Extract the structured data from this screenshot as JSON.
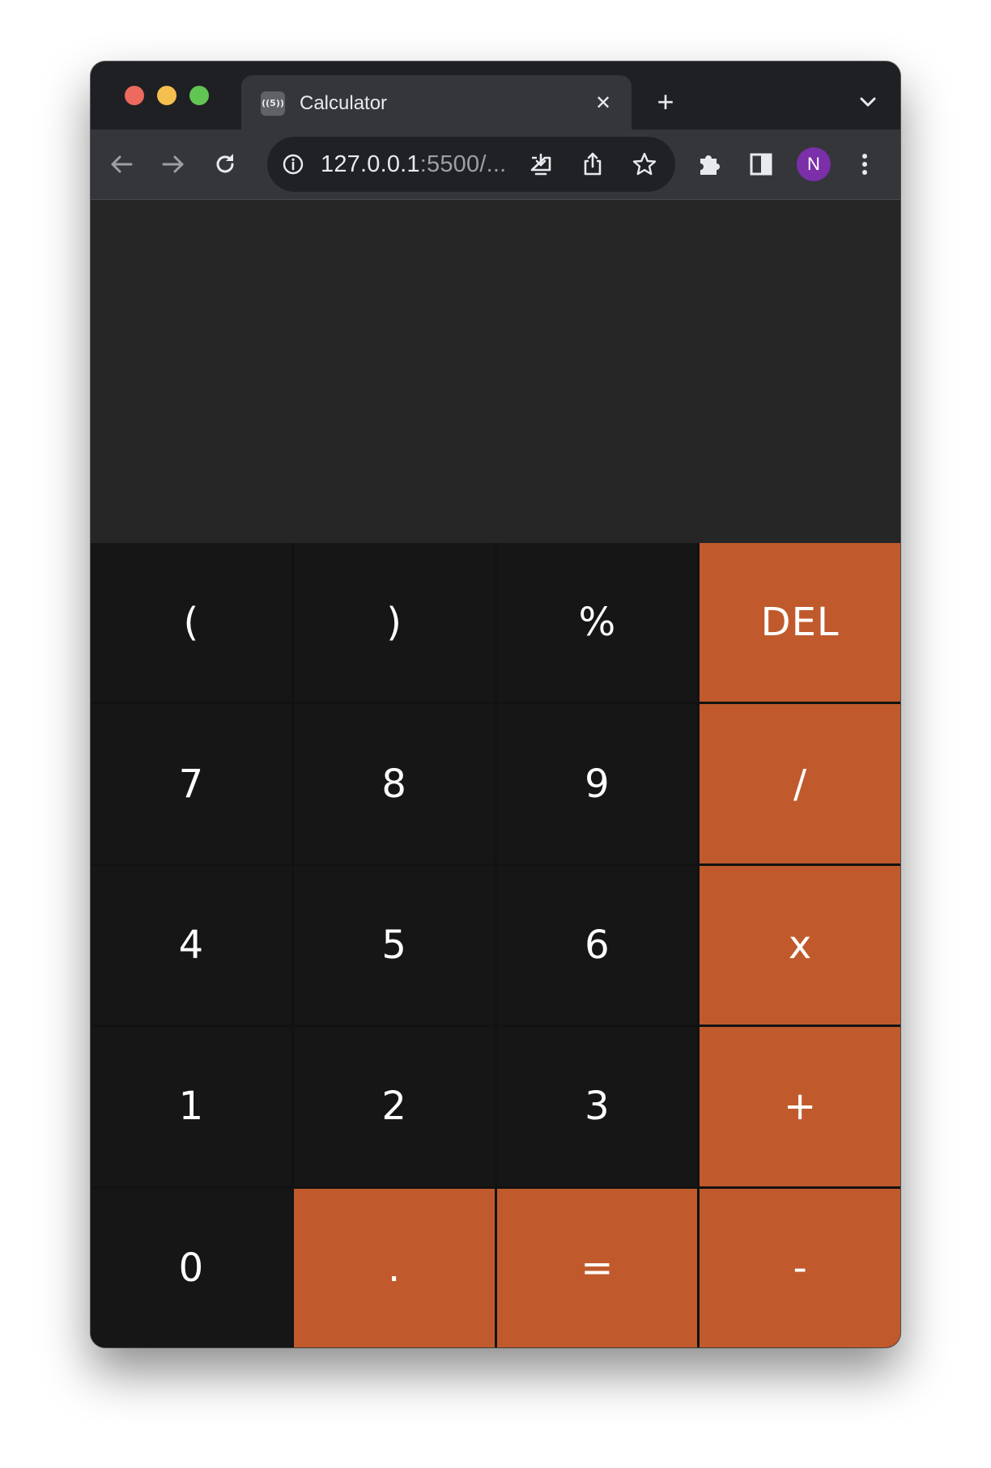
{
  "browser": {
    "tab": {
      "title": "Calculator",
      "favicon_text": "((5))",
      "close_symbol": "✕"
    },
    "new_tab_symbol": "+",
    "address": {
      "host": "127.0.0.1",
      "rest": ":5500/..."
    },
    "profile_initial": "N"
  },
  "calculator": {
    "display_value": "",
    "keys": [
      {
        "label": "(",
        "kind": "number"
      },
      {
        "label": ")",
        "kind": "number"
      },
      {
        "label": "%",
        "kind": "number"
      },
      {
        "label": "DEL",
        "kind": "operator"
      },
      {
        "label": "7",
        "kind": "number"
      },
      {
        "label": "8",
        "kind": "number"
      },
      {
        "label": "9",
        "kind": "number"
      },
      {
        "label": "/",
        "kind": "operator"
      },
      {
        "label": "4",
        "kind": "number"
      },
      {
        "label": "5",
        "kind": "number"
      },
      {
        "label": "6",
        "kind": "number"
      },
      {
        "label": "x",
        "kind": "operator"
      },
      {
        "label": "1",
        "kind": "number"
      },
      {
        "label": "2",
        "kind": "number"
      },
      {
        "label": "3",
        "kind": "number"
      },
      {
        "label": "+",
        "kind": "operator"
      },
      {
        "label": "0",
        "kind": "number"
      },
      {
        "label": ".",
        "kind": "operator"
      },
      {
        "label": "=",
        "kind": "operator"
      },
      {
        "label": "-",
        "kind": "operator"
      }
    ]
  },
  "colors": {
    "accent": "#c05a2c",
    "key_background": "#161616",
    "display_background": "#262627",
    "profile": "#7b2fa8"
  },
  "icons": {
    "back": "arrow-left-icon",
    "forward": "arrow-right-icon",
    "reload": "reload-icon",
    "info": "info-icon",
    "install": "install-app-icon",
    "share": "share-icon",
    "bookmark": "star-icon",
    "extensions": "puzzle-icon",
    "side_panel": "side-panel-icon",
    "menu": "kebab-menu-icon",
    "tab_search": "chevron-down-icon"
  }
}
